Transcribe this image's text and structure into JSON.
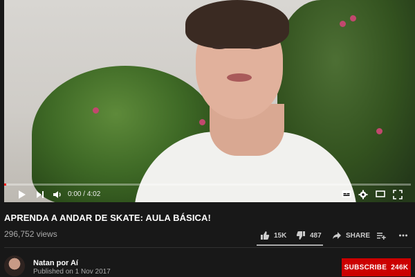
{
  "player": {
    "time_current": "0:00",
    "time_separator": "/",
    "time_total": "4:02",
    "progress_fraction": 0.0,
    "icons": [
      "play-icon",
      "next-icon",
      "volume-icon",
      "subtitles-icon",
      "settings-icon",
      "theater-icon",
      "fullscreen-icon"
    ]
  },
  "video": {
    "title": "APRENDA A ANDAR DE SKATE: AULA BÁSICA!",
    "views": "296,752 views"
  },
  "actions": {
    "like_count": "15K",
    "dislike_count": "487",
    "share_label": "SHARE"
  },
  "channel": {
    "name": "Natan por Aí",
    "published": "Published on 1 Nov 2017",
    "subscribe_label": "SUBSCRIBE",
    "subscriber_count": "246K"
  },
  "colors": {
    "background": "#181818",
    "accent_red": "#cc0000",
    "progress_red": "#ff0000",
    "muted_text": "#aaaaaa"
  }
}
